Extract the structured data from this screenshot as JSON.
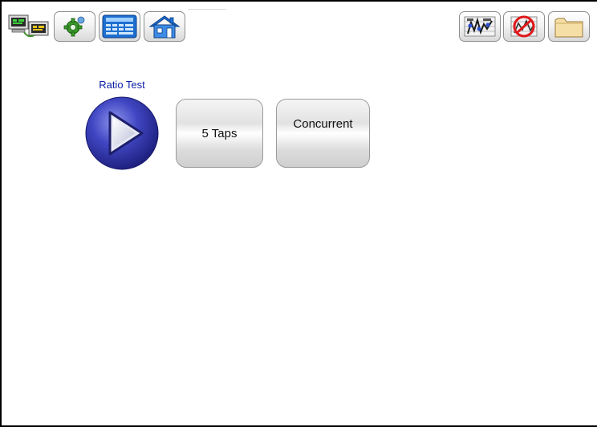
{
  "toolbar": {
    "left_icons": [
      "test-display-toggle-icon",
      "settings-gear-icon",
      "keypad-icon",
      "home-icon"
    ],
    "right_icons": [
      "results-icon",
      "clear-results-icon",
      "folder-icon"
    ]
  },
  "test": {
    "title": "Ratio Test",
    "start_icon": "play-icon"
  },
  "options": {
    "taps_label": "5 Taps",
    "concurrent_label": "Concurrent"
  },
  "colors": {
    "title_text": "#0a1ea6",
    "play_button": "#3a3fb0",
    "folder": "#f6dfa6"
  }
}
